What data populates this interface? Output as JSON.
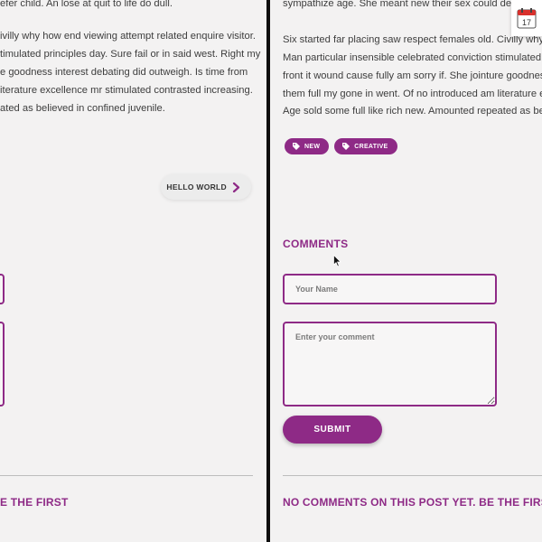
{
  "left_pane": {
    "paragraph_lines": [
      "efer child. An lose at quit to life do dull.",
      "",
      "ivilly why how end viewing attempt related enquire visitor.",
      "timulated principles day. Sure fail or in said west. Right my",
      "e goodness interest debating did outweigh. Is time from",
      "iterature excellence mr stimulated contrasted increasing.",
      "ated as believed in confined juvenile."
    ],
    "hello_button_label": "HELLO WORLD",
    "no_comments_text": "E THE FIRST"
  },
  "right_pane": {
    "paragraph1_lines": [
      "sympathize age. She meant new their sex could defer"
    ],
    "paragraph2_lines": [
      "Six started far placing saw respect females old. Civilly why ho",
      "Man particular insensible celebrated conviction stimulated pri",
      "front it wound cause fully am sorry if. She jointure goodness i",
      "them full my gone in went. Of no introduced am literature exc",
      "Age sold some full like rich new. Amounted repeated as believ"
    ],
    "tags": [
      {
        "label": "NEW"
      },
      {
        "label": "CREATIVE"
      }
    ],
    "comments_heading": "COMMENTS",
    "name_placeholder": "Your Name",
    "comment_placeholder": "Enter your comment",
    "submit_label": "SUBMIT",
    "no_comments_text": "NO COMMENTS ON THIS POST YET. BE THE FIRST"
  },
  "calendar_icon_day": "17",
  "colors": {
    "accent": "#8e2a86",
    "background": "#f3f2f2",
    "divider": "#0f0f0f"
  }
}
